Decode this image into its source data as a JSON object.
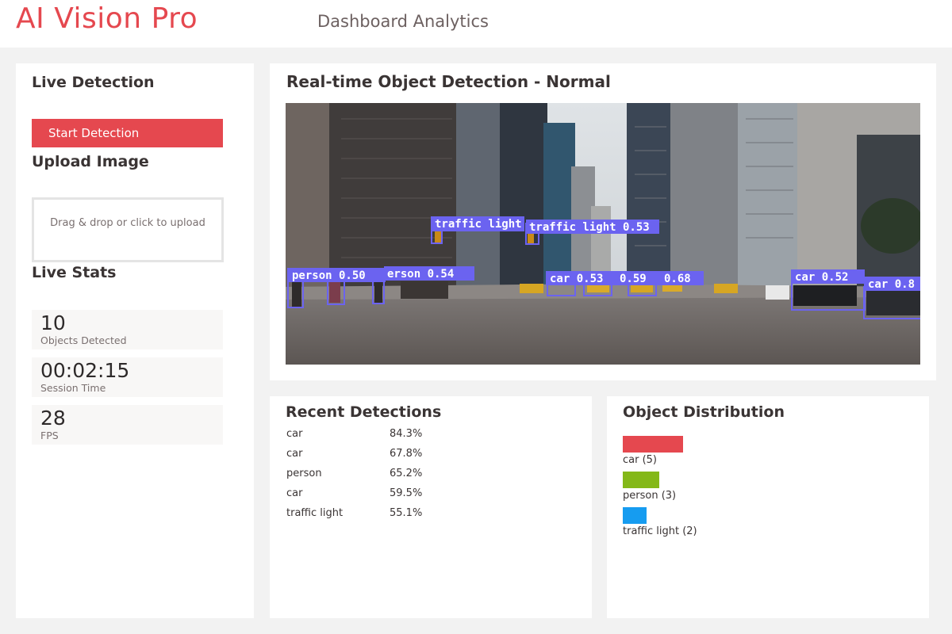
{
  "header": {
    "app_title": "AI Vision Pro",
    "subtitle": "Dashboard Analytics"
  },
  "sidebar": {
    "live_detection_title": "Live Detection",
    "start_button_label": "Start Detection",
    "upload_title": "Upload Image",
    "upload_hint": "Drag & drop or click to upload",
    "live_stats_title": "Live Stats",
    "stats": [
      {
        "value": "10",
        "label": "Objects Detected"
      },
      {
        "value": "00:02:15",
        "label": "Session Time"
      },
      {
        "value": "28",
        "label": "FPS"
      }
    ]
  },
  "viewer": {
    "title": "Real-time Object Detection - Normal",
    "box_color": "#6b63f0",
    "detections": [
      {
        "label": "traffic light 0.5",
        "shown": "traffic light"
      },
      {
        "label": "traffic light 0.53"
      },
      {
        "label": "person 0.50"
      },
      {
        "label": "person 0.54",
        "shown": "erson 0.54"
      },
      {
        "label": "car 0.53"
      },
      {
        "label": "0.59"
      },
      {
        "label": "0.68"
      },
      {
        "label": "car 0.52"
      },
      {
        "label": "car 0.8"
      }
    ]
  },
  "recent": {
    "title": "Recent Detections",
    "items": [
      {
        "name": "car",
        "confidence": "84.3%"
      },
      {
        "name": "car",
        "confidence": "67.8%"
      },
      {
        "name": "person",
        "confidence": "65.2%"
      },
      {
        "name": "car",
        "confidence": "59.5%"
      },
      {
        "name": "traffic light",
        "confidence": "55.1%"
      }
    ]
  },
  "distribution": {
    "title": "Object Distribution",
    "items": [
      {
        "label": "car (5)",
        "count": 5,
        "color": "#e5484f"
      },
      {
        "label": "person (3)",
        "count": 3,
        "color": "#84b818"
      },
      {
        "label": "traffic light (2)",
        "count": 2,
        "color": "#169cf0"
      }
    ]
  },
  "colors": {
    "accent": "#e5484f",
    "background": "#f2f2f2",
    "panel": "#ffffff"
  }
}
